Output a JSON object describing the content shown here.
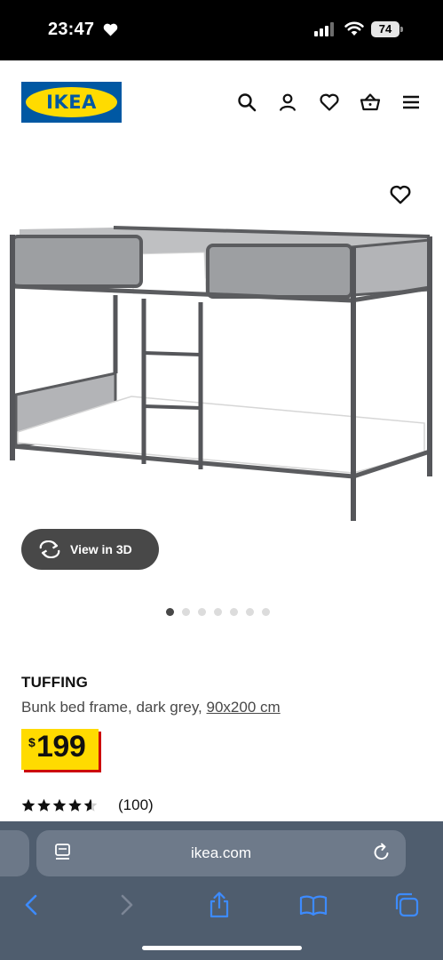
{
  "status_bar": {
    "time": "23:47",
    "battery": "74",
    "icons": [
      "heart-icon",
      "cellular-signal-icon",
      "wifi-icon",
      "battery-icon"
    ]
  },
  "header": {
    "logo_text": "IKEA",
    "icons": [
      "search-icon",
      "account-icon",
      "heart-icon",
      "basket-icon",
      "menu-icon"
    ]
  },
  "gallery": {
    "view_3d_label": "View in 3D",
    "image_count": 7,
    "active_index": 0
  },
  "product": {
    "name": "TUFFING",
    "description": "Bunk bed frame, dark grey, ",
    "size": "90x200 cm",
    "currency": "$",
    "price": "199",
    "rating": 4.5,
    "rating_count": "(100)"
  },
  "browser": {
    "url": "ikea.com",
    "toolbar": [
      "back-icon",
      "forward-icon",
      "share-icon",
      "bookmarks-icon",
      "tabs-icon"
    ]
  },
  "colors": {
    "ikea_blue": "#0058a3",
    "ikea_yellow": "#ffdb00",
    "price_shadow": "#cc0008",
    "safari_bar": "#4f5d6e",
    "button_dark": "#484848"
  }
}
